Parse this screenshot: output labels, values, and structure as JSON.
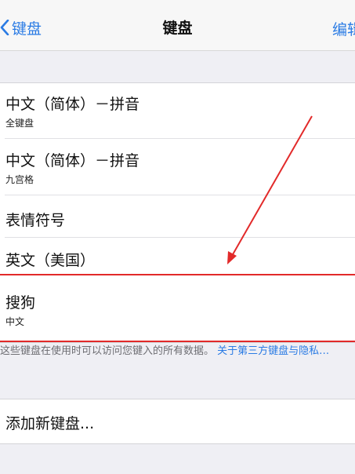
{
  "nav": {
    "back_label": "键盘",
    "title": "键盘",
    "edit_label": "编辑"
  },
  "keyboards": [
    {
      "title": "中文（简体）－拼音",
      "subtitle": "全键盘"
    },
    {
      "title": "中文（简体）－拼音",
      "subtitle": "九宫格"
    },
    {
      "title": "表情符号",
      "subtitle": ""
    },
    {
      "title": "英文（美国）",
      "subtitle": ""
    },
    {
      "title": "搜狗",
      "subtitle": "中文"
    }
  ],
  "footer": {
    "text": "这些键盘在使用时可以访问您键入的所有数据。",
    "link": "关于第三方键盘与隐私…"
  },
  "add_keyboard": {
    "label": "添加新键盘..."
  },
  "colors": {
    "accent": "#2a7be4",
    "annotation": "#e22a2a",
    "background": "#efeff4"
  }
}
